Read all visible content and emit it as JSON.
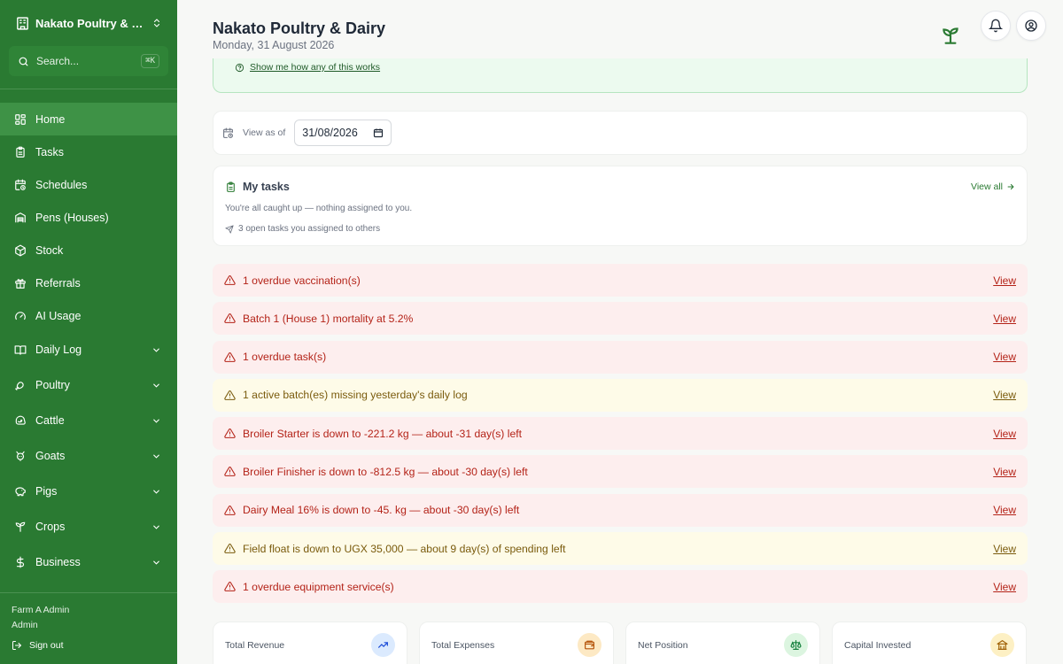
{
  "sidebar": {
    "farm_name": "Nakato Poultry & Dairy",
    "search_placeholder": "Search...",
    "search_shortcut": "⌘K",
    "items": [
      {
        "label": "Home",
        "icon": "home-grid-icon",
        "active": true
      },
      {
        "label": "Tasks",
        "icon": "clipboard-icon"
      },
      {
        "label": "Schedules",
        "icon": "calendar-clock-icon"
      },
      {
        "label": "Pens (Houses)",
        "icon": "warehouse-icon"
      },
      {
        "label": "Stock",
        "icon": "package-icon"
      },
      {
        "label": "Referrals",
        "icon": "gift-icon"
      },
      {
        "label": "AI Usage",
        "icon": "gauge-icon"
      }
    ],
    "groups": [
      {
        "label": "Daily Log",
        "icon": "book-icon"
      },
      {
        "label": "Poultry",
        "icon": "drumstick-icon"
      },
      {
        "label": "Cattle",
        "icon": "cattle-icon"
      },
      {
        "label": "Goats",
        "icon": "goat-icon"
      },
      {
        "label": "Pigs",
        "icon": "piggy-icon"
      },
      {
        "label": "Crops",
        "icon": "sprout-icon"
      },
      {
        "label": "Business",
        "icon": "dollar-icon"
      }
    ],
    "user_name": "Farm A Admin",
    "user_role": "Admin",
    "sign_out": "Sign out"
  },
  "header": {
    "title": "Nakato Poultry & Dairy",
    "date": "Monday, 31 August 2026"
  },
  "banner": {
    "help_link": "Show me how any of this works"
  },
  "view_as": {
    "label": "View as of",
    "date_value": "31/08/2026"
  },
  "tasks": {
    "title": "My tasks",
    "view_all": "View all",
    "caught_up": "You're all caught up — nothing assigned to you.",
    "assigned_to_others": "3 open tasks you assigned to others"
  },
  "alerts": [
    {
      "text": "1 overdue vaccination(s)",
      "level": "red",
      "action": "View"
    },
    {
      "text": "Batch 1 (House 1) mortality at 5.2%",
      "level": "red",
      "action": "View"
    },
    {
      "text": "1 overdue task(s)",
      "level": "red",
      "action": "View"
    },
    {
      "text": "1 active batch(es) missing yesterday's daily log",
      "level": "yellow",
      "action": "View"
    },
    {
      "text": "Broiler Starter is down to -221.2 kg — about -31 day(s) left",
      "level": "red",
      "action": "View"
    },
    {
      "text": "Broiler Finisher is down to -812.5 kg — about -30 day(s) left",
      "level": "red",
      "action": "View"
    },
    {
      "text": "Dairy Meal 16% is down to -45. kg — about -30 day(s) left",
      "level": "red",
      "action": "View"
    },
    {
      "text": "Field float is down to UGX 35,000 — about 9 day(s) of spending left",
      "level": "yellow",
      "action": "View"
    },
    {
      "text": "1 overdue equipment service(s)",
      "level": "red",
      "action": "View"
    }
  ],
  "kpis": [
    {
      "label": "Total Revenue",
      "icon": "trending-up-icon",
      "bg": "#dbeafe",
      "fg": "#1d4ed8"
    },
    {
      "label": "Total Expenses",
      "icon": "wallet-icon",
      "bg": "#fde9c4",
      "fg": "#b45309"
    },
    {
      "label": "Net Position",
      "icon": "scale-icon",
      "bg": "#dcf5e0",
      "fg": "#15803d"
    },
    {
      "label": "Capital Invested",
      "icon": "landmark-icon",
      "bg": "#fdf0c4",
      "fg": "#a16207"
    }
  ],
  "colors": {
    "sidebar_bg": "#2a7a32",
    "sidebar_active": "#3e9246",
    "alert_red_text": "#b42318",
    "alert_yellow_text": "#7a5b0d",
    "accent_green": "#2a7a32"
  }
}
